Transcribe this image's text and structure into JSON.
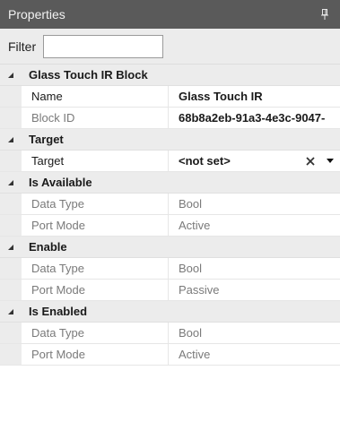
{
  "panel": {
    "title": "Properties",
    "pin_icon": "pin-icon"
  },
  "filter": {
    "label": "Filter",
    "value": "",
    "placeholder": ""
  },
  "categories": {
    "glass_touch": {
      "label": "Glass Touch IR Block",
      "rows": {
        "name": {
          "label": "Name",
          "value": "Glass Touch IR"
        },
        "block_id": {
          "label": "Block ID",
          "value": "68b8a2eb-91a3-4e3c-9047-"
        }
      }
    },
    "target": {
      "label": "Target",
      "rows": {
        "target": {
          "label": "Target",
          "value": "<not set>"
        }
      }
    },
    "is_available": {
      "label": "Is Available",
      "rows": {
        "data_type": {
          "label": "Data Type",
          "value": "Bool"
        },
        "port_mode": {
          "label": "Port Mode",
          "value": "Active"
        }
      }
    },
    "enable": {
      "label": "Enable",
      "rows": {
        "data_type": {
          "label": "Data Type",
          "value": "Bool"
        },
        "port_mode": {
          "label": "Port Mode",
          "value": "Passive"
        }
      }
    },
    "is_enabled": {
      "label": "Is Enabled",
      "rows": {
        "data_type": {
          "label": "Data Type",
          "value": "Bool"
        },
        "port_mode": {
          "label": "Port Mode",
          "value": "Active"
        }
      }
    }
  },
  "colors": {
    "titlebar": "#5a5a5a",
    "category_bg": "#ececec",
    "readonly_text": "#7a7a7a"
  }
}
